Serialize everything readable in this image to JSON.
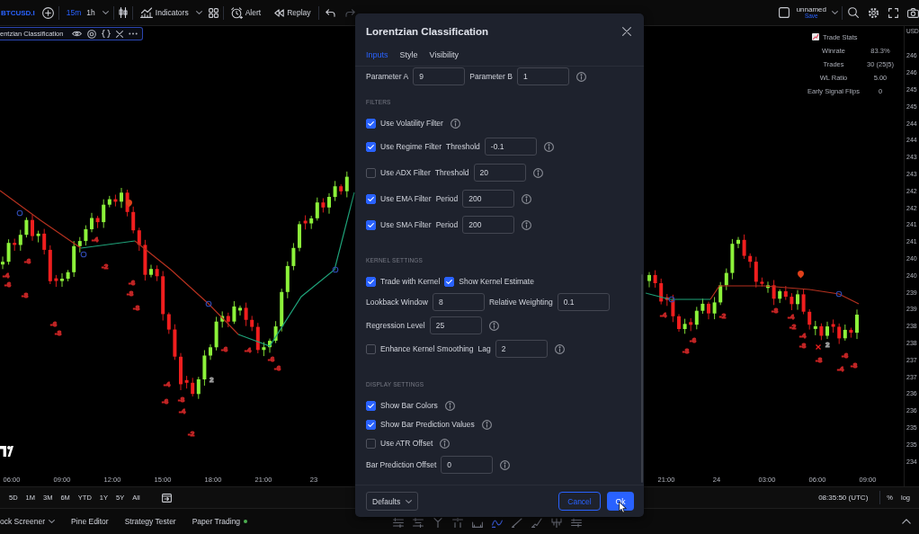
{
  "toolbar": {
    "symbol": "BTCUSD.I",
    "intervals": [
      {
        "label": "15m",
        "selected": true
      },
      {
        "label": "1h",
        "selected": false
      }
    ],
    "indicators": "Indicators",
    "alert": "Alert",
    "replay": "Replay",
    "layout_name": "unnamed",
    "layout_status": "Save"
  },
  "legend": {
    "title": "entzian Classification"
  },
  "trade_stats": {
    "title": "Trade Stats",
    "rows": [
      {
        "label": "Winrate",
        "value": "83.3%"
      },
      {
        "label": "Trades",
        "value": "30 (25|5)"
      },
      {
        "label": "WL Ratio",
        "value": "5.00"
      },
      {
        "label": "Early Signal Flips",
        "value": "0"
      }
    ]
  },
  "chart": {
    "prediction_labels": [
      {
        "text": "-4",
        "color": "#c62828"
      },
      {
        "text": "-6",
        "color": "#c62828"
      },
      {
        "text": "-6",
        "color": "#c62828"
      },
      {
        "text": "-8",
        "color": "#c62828"
      },
      {
        "text": "-6",
        "color": "#c62828"
      },
      {
        "text": "-8",
        "color": "#c62828"
      },
      {
        "text": "-4",
        "color": "#c62828"
      },
      {
        "text": "-2",
        "color": "#c62828"
      },
      {
        "text": "-6",
        "color": "#c62828"
      },
      {
        "text": "-8",
        "color": "#c62828"
      },
      {
        "text": "-8",
        "color": "#c62828"
      },
      {
        "text": "-4",
        "color": "#c62828"
      },
      {
        "text": "-6",
        "color": "#c62828"
      },
      {
        "text": "-8",
        "color": "#c62828"
      },
      {
        "text": "-4",
        "color": "#c62828"
      },
      {
        "text": "2",
        "color": "#9e9e9e"
      },
      {
        "text": "-2",
        "color": "#c62828"
      },
      {
        "text": "-6",
        "color": "#c62828"
      },
      {
        "text": "-4",
        "color": "#c62828"
      },
      {
        "text": "-6",
        "color": "#c62828"
      },
      {
        "text": "-6",
        "color": "#c62828"
      },
      {
        "text": "-4",
        "color": "#c62828"
      },
      {
        "text": "-6",
        "color": "#c62828"
      },
      {
        "text": "-8",
        "color": "#c62828"
      },
      {
        "text": "-2",
        "color": "#c62828"
      },
      {
        "text": "-8",
        "color": "#c62828"
      },
      {
        "text": "-4",
        "color": "#c62828"
      },
      {
        "text": "-2",
        "color": "#c62828"
      },
      {
        "text": "-4",
        "color": "#c62828"
      },
      {
        "text": "-8",
        "color": "#c62828"
      },
      {
        "text": "2",
        "color": "#9e9e9e"
      },
      {
        "text": "-8",
        "color": "#c62828"
      },
      {
        "text": "-6",
        "color": "#c62828"
      },
      {
        "text": "-4",
        "color": "#c62828"
      },
      {
        "text": "-8",
        "color": "#c62828"
      }
    ],
    "time_axis": {
      "left_labels": [
        "06:00",
        "09:00",
        "12:00",
        "15:00",
        "18:00",
        "21:00",
        "23"
      ],
      "right_labels": [
        "21:00",
        "24",
        "03:00",
        "06:00",
        "09:00"
      ]
    },
    "price_axis": {
      "currency": "USD",
      "labels": [
        "246",
        "246",
        "245",
        "245",
        "244",
        "244",
        "243",
        "243",
        "242",
        "242",
        "241",
        "241",
        "240",
        "240",
        "239",
        "239",
        "238",
        "238",
        "237",
        "237",
        "236",
        "236",
        "235",
        "235",
        "234"
      ]
    }
  },
  "range_bar": {
    "ranges": [
      "5D",
      "1M",
      "3M",
      "6M",
      "YTD",
      "1Y",
      "5Y",
      "All"
    ],
    "clock": "08:35:50 (UTC)",
    "percent": "%",
    "log": "log"
  },
  "bottom_panel": {
    "tabs": [
      {
        "label": "ock Screener",
        "kind": "dropdown"
      },
      {
        "label": "Pine Editor",
        "kind": "plain"
      },
      {
        "label": "Strategy Tester",
        "kind": "plain"
      },
      {
        "label": "Paper Trading",
        "kind": "status"
      }
    ]
  },
  "dialog": {
    "title": "Lorentzian Classification",
    "tabs": [
      {
        "label": "Inputs",
        "selected": true
      },
      {
        "label": "Style",
        "selected": false
      },
      {
        "label": "Visibility",
        "selected": false
      }
    ],
    "sections": [
      {
        "rows": [
          {
            "controls": [
              {
                "kind": "label",
                "text": "Parameter A"
              },
              {
                "kind": "field",
                "value": "9"
              },
              {
                "kind": "label",
                "text": "Parameter B"
              },
              {
                "kind": "field",
                "value": "1"
              },
              {
                "kind": "info"
              }
            ]
          }
        ]
      },
      {
        "heading": "FILTERS",
        "rows": [
          {
            "controls": [
              {
                "kind": "checkbox",
                "label": "Use Volatility Filter",
                "checked": true
              },
              {
                "kind": "info"
              }
            ]
          },
          {
            "controls": [
              {
                "kind": "checkbox",
                "label": "Use Regime Filter",
                "checked": true
              },
              {
                "kind": "label",
                "text": "Threshold"
              },
              {
                "kind": "field",
                "value": "-0.1"
              },
              {
                "kind": "info"
              }
            ]
          },
          {
            "controls": [
              {
                "kind": "checkbox",
                "label": "Use ADX Filter",
                "checked": false
              },
              {
                "kind": "label",
                "text": "Threshold"
              },
              {
                "kind": "field",
                "value": "20"
              },
              {
                "kind": "info"
              }
            ]
          },
          {
            "controls": [
              {
                "kind": "checkbox",
                "label": "Use EMA Filter",
                "checked": true
              },
              {
                "kind": "label",
                "text": "Period"
              },
              {
                "kind": "field",
                "value": "200"
              },
              {
                "kind": "info"
              }
            ]
          },
          {
            "controls": [
              {
                "kind": "checkbox",
                "label": "Use SMA Filter",
                "checked": true
              },
              {
                "kind": "label",
                "text": "Period"
              },
              {
                "kind": "field",
                "value": "200"
              },
              {
                "kind": "info"
              }
            ]
          }
        ]
      },
      {
        "heading": "KERNEL SETTINGS",
        "rows": [
          {
            "controls": [
              {
                "kind": "checkbox",
                "label": "Trade with Kernel",
                "checked": true
              },
              {
                "kind": "checkbox",
                "label": "Show Kernel Estimate",
                "checked": true
              }
            ]
          },
          {
            "controls": [
              {
                "kind": "label",
                "text": "Lookback Window"
              },
              {
                "kind": "field",
                "value": "8"
              },
              {
                "kind": "label",
                "text": "Relative Weighting"
              },
              {
                "kind": "field",
                "value": "0.1"
              }
            ]
          },
          {
            "controls": [
              {
                "kind": "label",
                "text": "Regression Level"
              },
              {
                "kind": "field",
                "value": "25"
              },
              {
                "kind": "info"
              }
            ]
          },
          {
            "controls": [
              {
                "kind": "checkbox",
                "label": "Enhance Kernel Smoothing",
                "checked": false
              },
              {
                "kind": "label",
                "text": "Lag"
              },
              {
                "kind": "field",
                "value": "2"
              },
              {
                "kind": "info"
              }
            ]
          }
        ]
      },
      {
        "heading": "DISPLAY SETTINGS",
        "rows": [
          {
            "controls": [
              {
                "kind": "checkbox",
                "label": "Show Bar Colors",
                "checked": true
              },
              {
                "kind": "info"
              }
            ]
          },
          {
            "controls": [
              {
                "kind": "checkbox",
                "label": "Show Bar Prediction Values",
                "checked": true
              },
              {
                "kind": "info"
              }
            ]
          },
          {
            "controls": [
              {
                "kind": "checkbox",
                "label": "Use ATR Offset",
                "checked": false
              },
              {
                "kind": "info"
              }
            ]
          },
          {
            "controls": [
              {
                "kind": "label",
                "text": "Bar Prediction Offset"
              },
              {
                "kind": "field",
                "value": "0"
              },
              {
                "kind": "info"
              }
            ]
          }
        ]
      }
    ],
    "footer": {
      "defaults": "Defaults",
      "cancel": "Cancel",
      "ok": "Ok"
    }
  }
}
